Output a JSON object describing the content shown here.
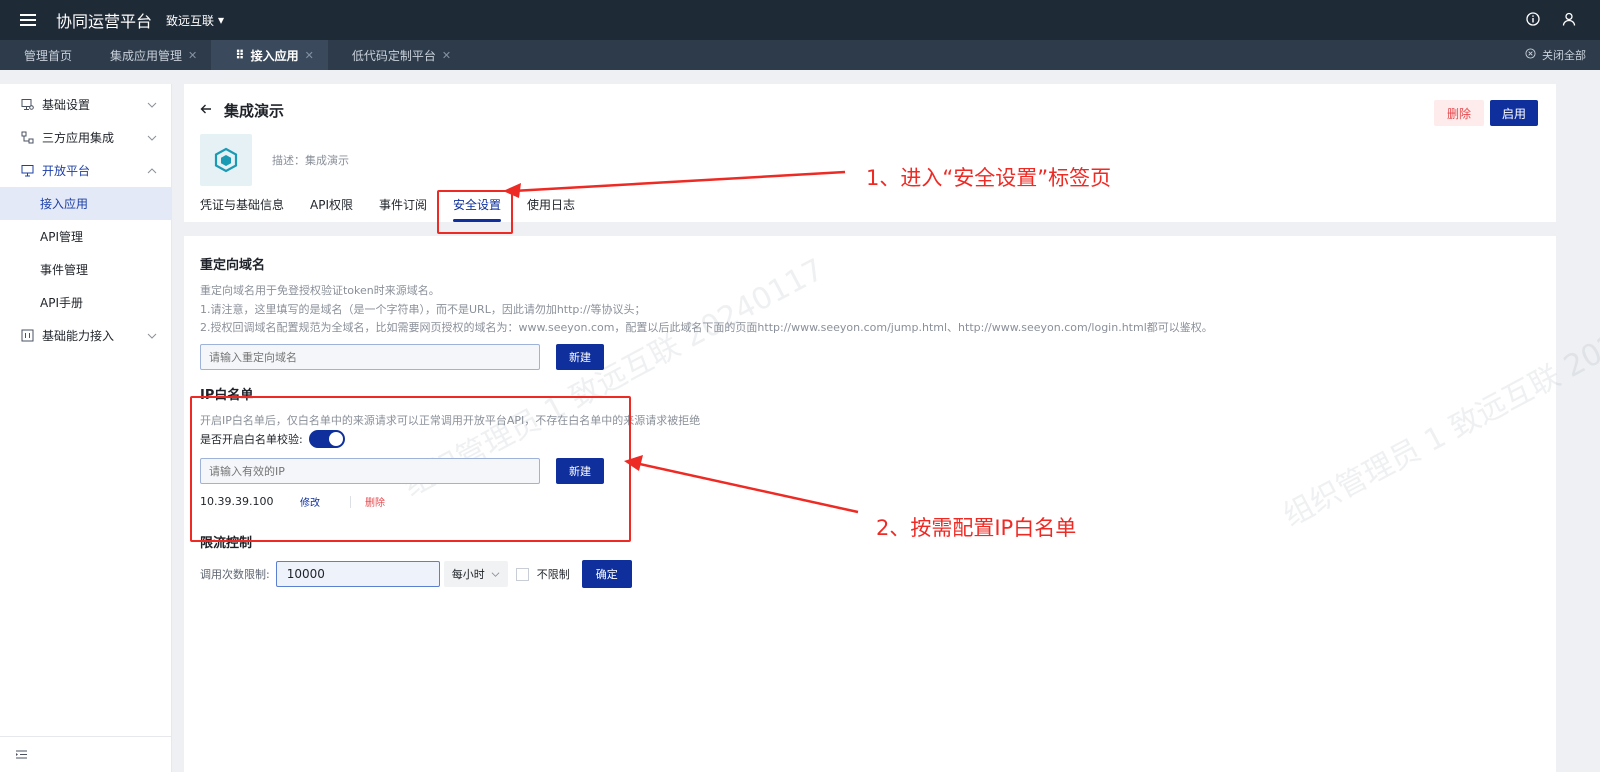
{
  "topbar": {
    "app_title": "协同运营平台",
    "org_name": "致远互联",
    "icons": [
      "menu-icon",
      "info-icon",
      "user-icon"
    ]
  },
  "tabs": [
    {
      "label": "管理首页",
      "closable": false,
      "active": false
    },
    {
      "label": "集成应用管理",
      "closable": true,
      "active": false
    },
    {
      "label": "接入应用",
      "closable": true,
      "active": true
    },
    {
      "label": "低代码定制平台",
      "closable": true,
      "active": false
    }
  ],
  "close_all_label": "关闭全部",
  "sidebar": {
    "items": [
      {
        "label": "基础设置",
        "icon": "monitor-settings-icon",
        "expanded": false
      },
      {
        "label": "三方应用集成",
        "icon": "flow-icon",
        "expanded": false
      },
      {
        "label": "开放平台",
        "icon": "desktop-icon",
        "expanded": true
      },
      {
        "label": "接入应用",
        "sub": true,
        "active": true
      },
      {
        "label": "API管理",
        "sub": true
      },
      {
        "label": "事件管理",
        "sub": true
      },
      {
        "label": "API手册",
        "sub": true
      },
      {
        "label": "基础能力接入",
        "icon": "grid-icon",
        "expanded": false
      }
    ]
  },
  "header": {
    "title": "集成演示",
    "description": "描述：集成演示",
    "delete_label": "删除",
    "enable_label": "启用",
    "subtabs": [
      "凭证与基础信息",
      "API权限",
      "事件订阅",
      "安全设置",
      "使用日志"
    ],
    "active_subtab": "安全设置"
  },
  "redirect": {
    "title": "重定向域名",
    "hints": [
      "重定向域名用于免登授权验证token时来源域名。",
      "1.请注意，这里填写的是域名（是一个字符串），而不是URL，因此请勿加http://等协议头；",
      "2.授权回调域名配置规范为全域名，比如需要网页授权的域名为：www.seeyon.com，配置以后此域名下面的页面http://www.seeyon.com/jump.html、http://www.seeyon.com/login.html都可以鉴权。"
    ],
    "placeholder": "请输入重定向域名",
    "button": "新建"
  },
  "ip_whitelist": {
    "title": "IP白名单",
    "hint": "开启IP白名单后，仅白名单中的来源请求可以正常调用开放平台API，不存在白名单中的来源请求被拒绝",
    "toggle_label": "是否开启白名单校验:",
    "toggle_on": true,
    "placeholder": "请输入有效的IP",
    "button": "新建",
    "entries": [
      {
        "ip": "10.39.39.100",
        "edit": "修改",
        "delete": "删除"
      }
    ]
  },
  "rate_limit": {
    "title": "限流控制",
    "label": "调用次数限制:",
    "value": "10000",
    "period": "每小时",
    "unlimited_label": "不限制",
    "unlimited_checked": false,
    "confirm": "确定"
  },
  "watermark": "组织管理员 1 致远互联 20240117",
  "annotations": {
    "step1": "1、进入“安全设置”标签页",
    "step2": "2、按需配置IP白名单"
  },
  "colors": {
    "topbar": "#1f2a37",
    "primary": "#0e2f9c",
    "danger": "#e5484d",
    "annotation": "#ee2a24"
  }
}
